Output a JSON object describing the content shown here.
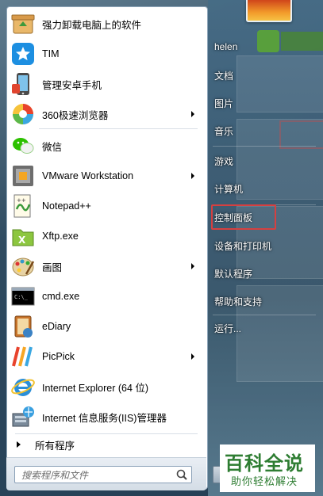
{
  "left_items": [
    {
      "label": "强力卸载电脑上的软件",
      "icon": "recycle-box-icon",
      "submenu": false
    },
    {
      "label": "TIM",
      "icon": "tim-icon",
      "submenu": false
    },
    {
      "label": "管理安卓手机",
      "icon": "android-manager-icon",
      "submenu": false
    },
    {
      "label": "360极速浏览器",
      "icon": "browser-360-icon",
      "submenu": true
    },
    {
      "label": "微信",
      "icon": "wechat-icon",
      "submenu": false
    },
    {
      "label": "VMware Workstation",
      "icon": "vmware-icon",
      "submenu": true
    },
    {
      "label": "Notepad++",
      "icon": "notepadpp-icon",
      "submenu": false
    },
    {
      "label": "Xftp.exe",
      "icon": "xftp-icon",
      "submenu": false
    },
    {
      "label": "画图",
      "icon": "paint-icon",
      "submenu": true
    },
    {
      "label": "cmd.exe",
      "icon": "cmd-icon",
      "submenu": false
    },
    {
      "label": "eDiary",
      "icon": "ediary-icon",
      "submenu": false
    },
    {
      "label": "PicPick",
      "icon": "picpick-icon",
      "submenu": true
    },
    {
      "label": "Internet Explorer (64 位)",
      "icon": "ie-icon",
      "submenu": false
    },
    {
      "label": "Internet 信息服务(IIS)管理器",
      "icon": "iis-icon",
      "submenu": false
    }
  ],
  "all_programs": "所有程序",
  "search": {
    "placeholder": "搜索程序和文件"
  },
  "right_items": [
    {
      "label": "helen"
    },
    {
      "label": "文档"
    },
    {
      "label": "图片"
    },
    {
      "label": "音乐"
    },
    {
      "label": "游戏"
    },
    {
      "label": "计算机"
    },
    {
      "label": "控制面板",
      "highlight": true
    },
    {
      "label": "设备和打印机"
    },
    {
      "label": "默认程序"
    },
    {
      "label": "帮助和支持"
    },
    {
      "label": "运行..."
    }
  ],
  "watermark": {
    "line1": "百科全说",
    "line2": "助你轻松解决"
  },
  "colors": {
    "highlight_box": "#d64040",
    "panel_bg": "#ffffff",
    "watermark": "#2e7d32"
  }
}
